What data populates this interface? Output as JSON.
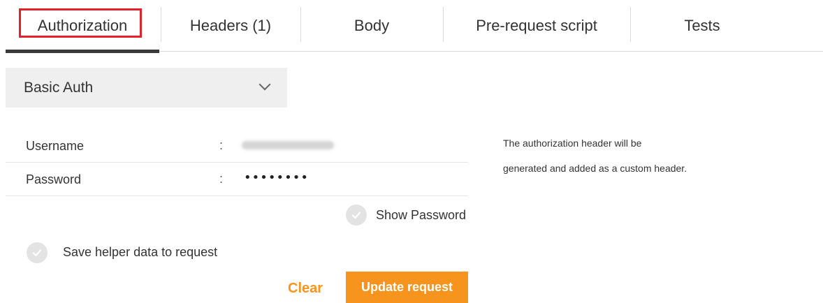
{
  "tabs": [
    {
      "label": "Authorization",
      "active": true
    },
    {
      "label": "Headers (1)",
      "active": false
    },
    {
      "label": "Body",
      "active": false
    },
    {
      "label": "Pre-request script",
      "active": false
    },
    {
      "label": "Tests",
      "active": false
    }
  ],
  "auth": {
    "type_label": "Basic Auth",
    "dropdown_icon": "chevron-down-icon"
  },
  "fields": {
    "username_label": "Username",
    "username_colon": ":",
    "password_label": "Password",
    "password_colon": ":",
    "password_value": "••••••••"
  },
  "options": {
    "show_password_label": "Show Password",
    "save_helper_label": "Save helper data to request",
    "check_icon": "check-circle-icon"
  },
  "help": {
    "line1": "The authorization header will be",
    "line2": "generated and added as a custom header."
  },
  "actions": {
    "clear_label": "Clear",
    "update_label": "Update request"
  },
  "colors": {
    "accent": "#f7941d",
    "highlight": "#e3212b",
    "active_underline": "#3a3a3a"
  }
}
